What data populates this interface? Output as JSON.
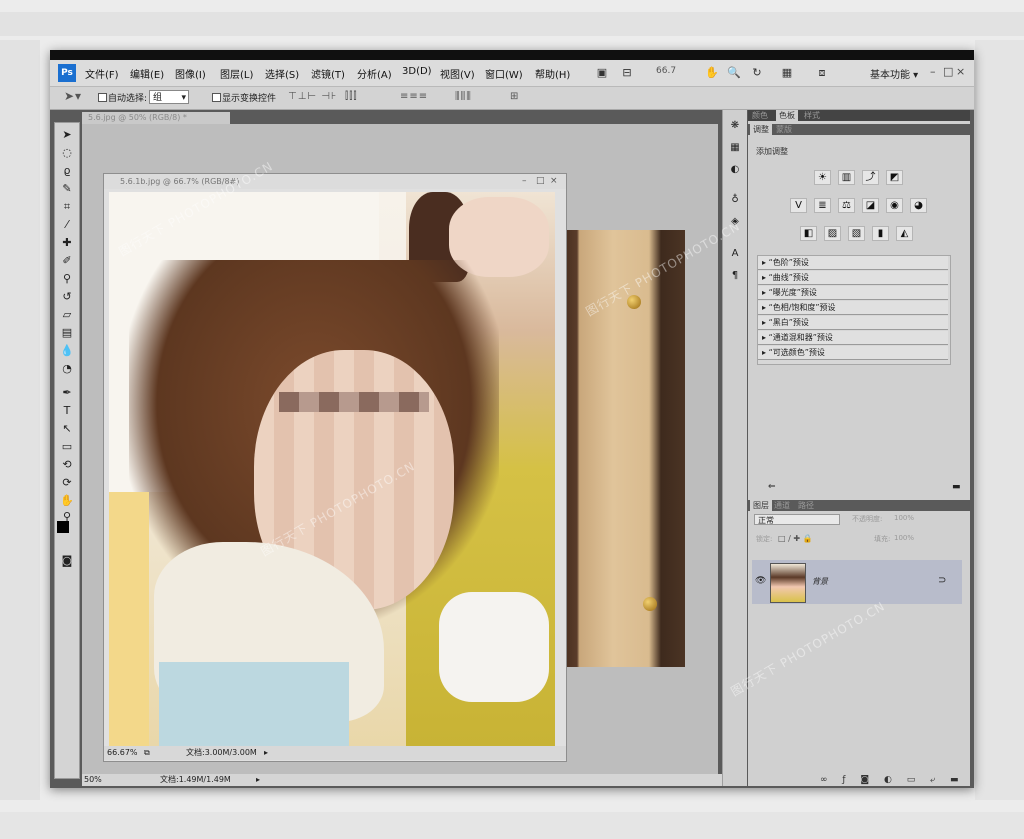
{
  "menu": {
    "items": [
      "文件(F)",
      "编辑(E)",
      "图像(I)",
      "图层(L)",
      "选择(S)",
      "滤镜(T)",
      "分析(A)",
      "3D(D)",
      "视图(V)",
      "窗口(W)",
      "帮助(H)"
    ],
    "zoom": "66.7",
    "workspace": "基本功能 ▾",
    "win_controls": [
      "–",
      "□",
      "×"
    ]
  },
  "options": {
    "auto_select_label": "自动选择:",
    "auto_select_value": "组",
    "show_transform_label": "显示变换控件"
  },
  "document": {
    "tab_title": "5.6.jpg @ 50% (RGB/8) *",
    "window_title": "5.6.1b.jpg @ 66.7% (RGB/8#)",
    "zoom_status": "66.67%",
    "doc_size": "文档:3.00M/3.00M"
  },
  "statusbar": {
    "zoom": "50%",
    "doc_size": "文档:1.49M/1.49M"
  },
  "panels": {
    "top_tabs": [
      "颜色",
      "色板",
      "样式"
    ],
    "adj_tabs": [
      "调整",
      "蒙版"
    ],
    "adj_title": "添加调整",
    "presets": [
      "“色阶”预设",
      "“曲线”预设",
      "“曝光度”预设",
      "“色相/饱和度”预设",
      "“黑白”预设",
      "“通道混和器”预设",
      "“可选颜色”预设"
    ],
    "layer_tabs": [
      "图层",
      "通道",
      "路径"
    ],
    "blend_mode": "正常",
    "opacity_label": "不透明度:",
    "opacity_value": "100%",
    "lock_label": "锁定:",
    "fill_label": "填充:",
    "fill_value": "100%",
    "layer_name": "背景"
  },
  "watermark": "图行天下 PHOTOPHOTO.CN",
  "colors": {
    "accent": "#1a6fd0",
    "layer_selected": "#b8bccb"
  }
}
